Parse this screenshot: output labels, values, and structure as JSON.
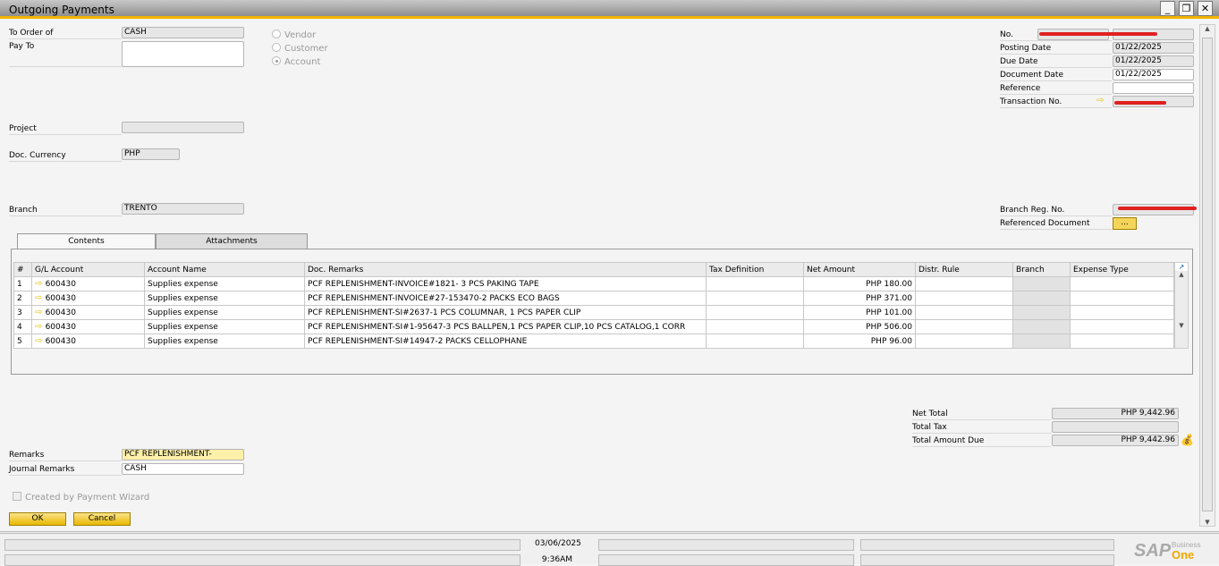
{
  "window": {
    "title": "Outgoing Payments",
    "minimize": "_",
    "restore": "❐",
    "close": "✕"
  },
  "header": {
    "to_order_of_label": "To Order of",
    "to_order_of": "CASH",
    "pay_to_label": "Pay To",
    "pay_to": "",
    "radios": [
      {
        "label": "Vendor",
        "selected": false
      },
      {
        "label": "Customer",
        "selected": false
      },
      {
        "label": "Account",
        "selected": true
      }
    ],
    "project_label": "Project",
    "project": "",
    "currency_label": "Doc. Currency",
    "currency": "PHP",
    "branch_label": "Branch",
    "branch": "TRENTO"
  },
  "right": {
    "no_label": "No.",
    "posting_date_label": "Posting Date",
    "posting_date": "01/22/2025",
    "due_date_label": "Due Date",
    "due_date": "01/22/2025",
    "document_date_label": "Document Date",
    "document_date": "01/22/2025",
    "reference_label": "Reference",
    "reference": "",
    "transaction_no_label": "Transaction No.",
    "branch_reg_label": "Branch Reg. No.",
    "ref_doc_label": "Referenced Document",
    "ref_doc_button": "..."
  },
  "tabs": [
    {
      "label": "Contents",
      "active": true
    },
    {
      "label": "Attachments",
      "active": false
    }
  ],
  "table": {
    "columns": [
      "#",
      "G/L Account",
      "Account Name",
      "Doc. Remarks",
      "Tax Definition",
      "Net Amount",
      "Distr. Rule",
      "Branch",
      "Expense Type"
    ],
    "rows": [
      {
        "n": "1",
        "gl": "600430",
        "name": "Supplies expense",
        "remarks": "PCF REPLENISHMENT-INVOICE#1821- 3 PCS PAKING TAPE",
        "amount": "PHP 180.00"
      },
      {
        "n": "2",
        "gl": "600430",
        "name": "Supplies expense",
        "remarks": "PCF REPLENISHMENT-INVOICE#27-153470-2 PACKS ECO BAGS",
        "amount": "PHP 371.00"
      },
      {
        "n": "3",
        "gl": "600430",
        "name": "Supplies expense",
        "remarks": "PCF REPLENISHMENT-SI#2637-1 PCS COLUMNAR, 1 PCS PAPER CLIP",
        "amount": "PHP 101.00"
      },
      {
        "n": "4",
        "gl": "600430",
        "name": "Supplies expense",
        "remarks": "PCF REPLENISHMENT-SI#1-95647-3 PCS BALLPEN,1 PCS PAPER CLIP,10 PCS CATALOG,1 CORR",
        "amount": "PHP 506.00"
      },
      {
        "n": "5",
        "gl": "600430",
        "name": "Supplies expense",
        "remarks": "PCF REPLENISHMENT-SI#14947-2 PACKS CELLOPHANE",
        "amount": "PHP 96.00"
      }
    ]
  },
  "totals": {
    "net_total_label": "Net Total",
    "net_total": "PHP 9,442.96",
    "total_tax_label": "Total Tax",
    "total_tax": "",
    "total_due_label": "Total Amount Due",
    "total_due": "PHP 9,442.96"
  },
  "footer": {
    "remarks_label": "Remarks",
    "remarks": "PCF REPLENISHMENT-",
    "journal_label": "Journal Remarks",
    "journal": "CASH",
    "wizard_label": "Created by Payment Wizard",
    "ok": "OK",
    "cancel": "Cancel"
  },
  "statusbar": {
    "date": "03/06/2025",
    "time": "9:36AM",
    "logo_sap": "SAP",
    "logo_business": "Business",
    "logo_one": "One"
  }
}
